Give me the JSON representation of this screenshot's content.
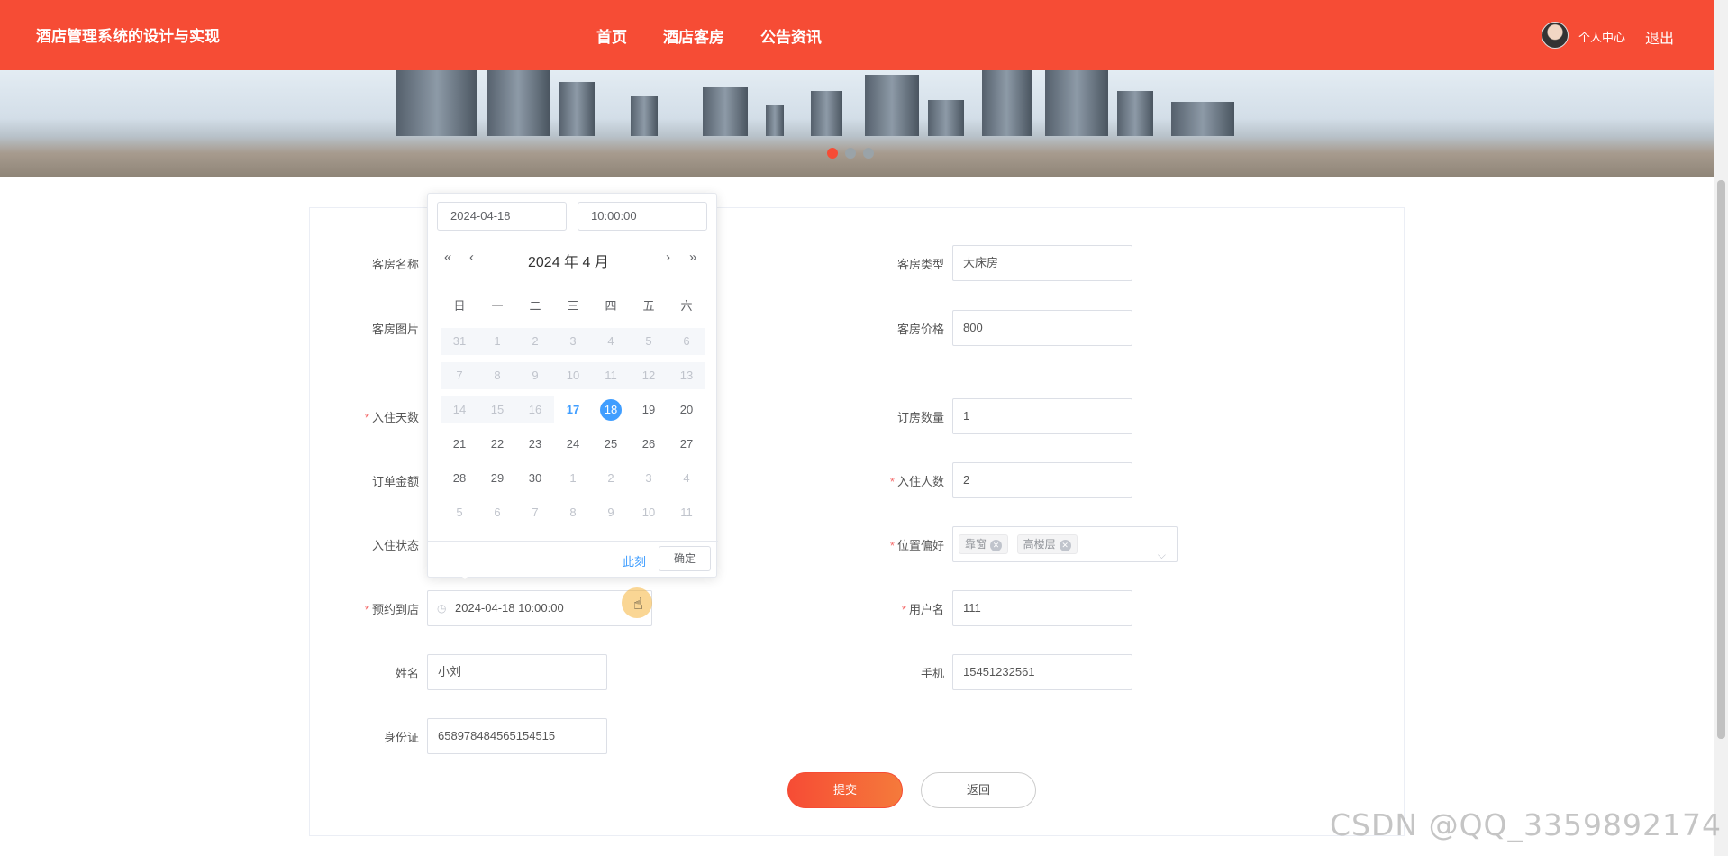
{
  "header": {
    "brand": "酒店管理系统的设计与实现",
    "nav": [
      "首页",
      "酒店客房",
      "公告资讯"
    ],
    "user_center": "个人中心",
    "logout": "退出"
  },
  "carousel": {
    "active_index": 0,
    "count": 3
  },
  "form": {
    "room_name_label": "客房名称",
    "room_type_label": "客房类型",
    "room_type_value": "大床房",
    "room_image_label": "客房图片",
    "room_price_label": "客房价格",
    "room_price_value": "800",
    "days_label": "入住天数",
    "room_count_label": "订房数量",
    "room_count_value": "1",
    "amount_label": "订单金额",
    "guests_label": "入住人数",
    "guests_value": "2",
    "status_label": "入住状态",
    "pref_label": "位置偏好",
    "pref_tags": [
      "靠窗",
      "高楼层"
    ],
    "arrival_label": "预约到店",
    "arrival_value": "2024-04-18 10:00:00",
    "username_label": "用户名",
    "username_value": "111",
    "name_label": "姓名",
    "name_value": "小刘",
    "phone_label": "手机",
    "phone_value": "15451232561",
    "id_label": "身份证",
    "id_value": "658978484565154515",
    "submit": "提交",
    "back": "返回"
  },
  "datepicker": {
    "date_input": "2024-04-18",
    "time_input": "10:00:00",
    "title": "2024 年  4 月",
    "weekdays": [
      "日",
      "一",
      "二",
      "三",
      "四",
      "五",
      "六"
    ],
    "rows": [
      [
        "31",
        "1",
        "2",
        "3",
        "4",
        "5",
        "6"
      ],
      [
        "7",
        "8",
        "9",
        "10",
        "11",
        "12",
        "13"
      ],
      [
        "14",
        "15",
        "16",
        "17",
        "18",
        "19",
        "20"
      ],
      [
        "21",
        "22",
        "23",
        "24",
        "25",
        "26",
        "27"
      ],
      [
        "28",
        "29",
        "30",
        "1",
        "2",
        "3",
        "4"
      ],
      [
        "5",
        "6",
        "7",
        "8",
        "9",
        "10",
        "11"
      ]
    ],
    "today": "17",
    "selected": "18",
    "now_label": "此刻",
    "ok_label": "确定"
  },
  "watermark": "CSDN @QQ_3359892174"
}
